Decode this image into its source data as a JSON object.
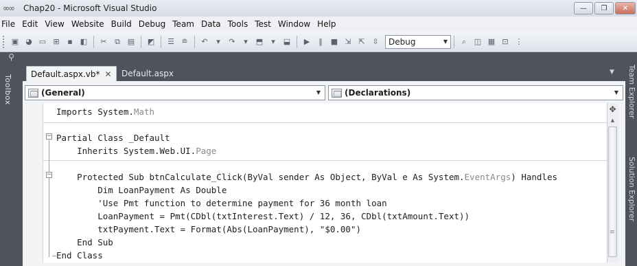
{
  "window": {
    "title": "Chap20 - Microsoft Visual Studio",
    "app_icon": "infinity-icon",
    "controls": [
      "minimize-icon",
      "restore-icon",
      "close-icon"
    ]
  },
  "menu": {
    "items": [
      {
        "label": "File"
      },
      {
        "label": "Edit"
      },
      {
        "label": "View"
      },
      {
        "label": "Website"
      },
      {
        "label": "Build"
      },
      {
        "label": "Debug"
      },
      {
        "label": "Team"
      },
      {
        "label": "Data"
      },
      {
        "label": "Tools"
      },
      {
        "label": "Test"
      },
      {
        "label": "Window"
      },
      {
        "label": "Help"
      }
    ]
  },
  "toolbar": {
    "config_value": "Debug"
  },
  "toolbox": {
    "label": "Toolbox"
  },
  "right_panels": {
    "label1": "Team Explorer",
    "label2": "Solution Explorer"
  },
  "tabs": [
    {
      "label": "Default.aspx.vb*",
      "active": true
    },
    {
      "label": "Default.aspx",
      "active": false
    }
  ],
  "nav": {
    "class_combo": "(General)",
    "member_combo": "(Declarations)"
  },
  "code": {
    "lines": [
      {
        "parts": [
          {
            "t": "Imports System.",
            "c": "kw"
          },
          {
            "t": "Math",
            "c": "ty"
          }
        ]
      },
      {
        "parts": [
          {
            "t": "",
            "c": "kw"
          }
        ]
      },
      {
        "parts": [
          {
            "t": "Partial Class _Default",
            "c": "kw"
          }
        ]
      },
      {
        "parts": [
          {
            "t": "    Inherits System.Web.UI.",
            "c": "kw"
          },
          {
            "t": "Page",
            "c": "ty"
          }
        ]
      },
      {
        "parts": [
          {
            "t": "",
            "c": "kw"
          }
        ]
      },
      {
        "parts": [
          {
            "t": "    Protected Sub btnCalculate_Click(ByVal sender As Object, ByVal e As System.",
            "c": "kw"
          },
          {
            "t": "EventArgs",
            "c": "ty"
          },
          {
            "t": ") Handles",
            "c": "kw"
          }
        ]
      },
      {
        "parts": [
          {
            "t": "        Dim LoanPayment As Double",
            "c": "kw"
          }
        ]
      },
      {
        "parts": [
          {
            "t": "        'Use Pmt function to determine payment for 36 month loan",
            "c": "cm"
          }
        ]
      },
      {
        "parts": [
          {
            "t": "        LoanPayment = Pmt(CDbl(txtInterest.Text) / 12, 36, CDbl(txtAmount.Text))",
            "c": "kw"
          }
        ]
      },
      {
        "parts": [
          {
            "t": "        txtPayment.Text = Format(Abs(LoanPayment), \"$0.00\")",
            "c": "kw"
          }
        ]
      },
      {
        "parts": [
          {
            "t": "    End Sub",
            "c": "kw"
          }
        ]
      },
      {
        "parts": [
          {
            "t": "End Class",
            "c": "kw"
          }
        ]
      }
    ]
  }
}
